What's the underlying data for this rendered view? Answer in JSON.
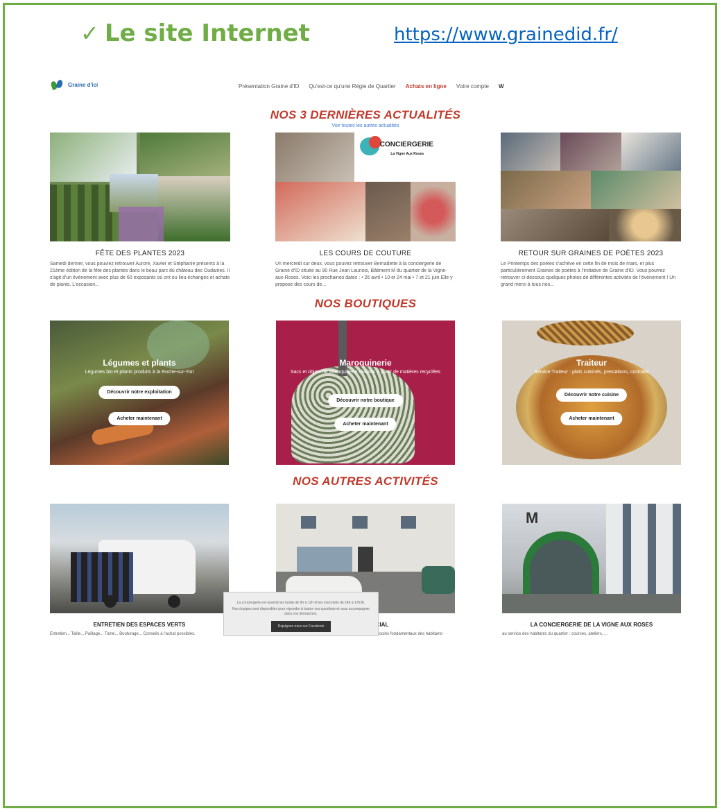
{
  "doc": {
    "heading": "Le site Internet",
    "url": "https://www.grainedid.fr/"
  },
  "site": {
    "logo_text": "Graine d'ici",
    "menu": [
      "Présentation Graine d'ID",
      "Qu'est-ce qu'une Régie de Quartier",
      "Achats en ligne",
      "Votre compte",
      "W"
    ],
    "news_title": "NOS 3 DERNIÈRES ACTUALITÉS",
    "news_link": "Voir toutes les autres actualités",
    "news": [
      {
        "title": "FÊTE DES PLANTES 2023",
        "text": "Samedi dernier, vous pouviez retrouver Aurore, Xavier et Stéphanie présents à la 21ème édition de la fête des plantes dans le beau parc du château des Oudairies. Il s'agit d'un événement avec plus de 60 exposants où ont eu lieu échanges et achats de plants. L'occasion..."
      },
      {
        "title": "LES COURS DE COUTURE",
        "text": "Un mercredi sur deux, vous pouvez retrouver Bernadette à la conciergerie de Graine d'ID située au 90 Rue Jean Launois, Bâtiment M du quartier de la Vigne-aux-Roses. Voici les prochaines dates : • 26 avril • 10 et 24 mai • 7 et 21 juin Elle y propose des cours de..."
      },
      {
        "title": "RETOUR SUR GRAINES DE POÈTES 2023",
        "text": "Le Printemps des poètes s'achève en cette fin de mois de mars, et plus particulièrement Graines de poètes à l'initiative de Graine d'ID. Vous pourrez retrouver ci-dessous quelques photos de différentes activités de l'événement ! Un grand merci à tous nos..."
      }
    ],
    "concierge_logo": "CONCIERGERIE",
    "concierge_sub": "La Vigne Aux Roses",
    "shops_title": "NOS BOUTIQUES",
    "shops": [
      {
        "title": "Légumes et plants",
        "desc": "Légumes bio et plants produits à la Roche-sur-Yon",
        "btn1": "Découvrir notre exploitation",
        "btn2": "Acheter maintenant"
      },
      {
        "title": "Maroquinerie",
        "desc": "Sacs et objets de Maroquinerie réalisés à partir de matières recyclées",
        "btn1": "Découvrir notre boutique",
        "btn2": "Acheter maintenant"
      },
      {
        "title": "Traiteur",
        "desc": "Service Traiteur : plats cuisinés, prestations, cocktails",
        "btn1": "Découvrir notre cuisine",
        "btn2": "Acheter maintenant"
      }
    ],
    "acts_title": "NOS AUTRES ACTIVITÉS",
    "acts": [
      {
        "title": "ENTRETIEN DES ESPACES VERTS",
        "text": "Entretien... Taille... Paillage... Tonte... Bouturage... Conseils à l'achat possibles."
      },
      {
        "title": "LE PÔLE SOCIAL",
        "text": "Les activités de la Régie permettent de répondre aux besoins fondamentaux des habitants"
      },
      {
        "title": "LA CONCIERGERIE DE LA VIGNE AUX ROSES",
        "text": "au service des habitants du quartier : courses, ateliers, ..."
      }
    ],
    "footer_line1": "La conciergerie est ouverte les lundis de 9h à 12h et les mercredis de 14h à 17h30.",
    "footer_line2": "Nos équipes sont disponibles pour répondre à toutes vos questions et vous accompagner dans vos démarches.",
    "footer_btn": "Rejoignez-nous sur Facebook"
  }
}
